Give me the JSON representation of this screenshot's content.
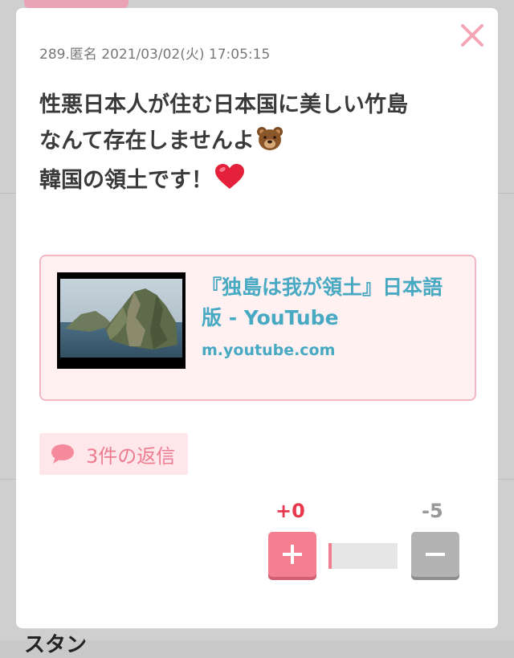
{
  "post": {
    "meta": "289.匿名 2021/03/02(火) 17:05:15",
    "lines": [
      "性悪日本人が住む日本国に美しい竹島",
      "なんて存在しませんよ",
      "韓国の領土です！"
    ],
    "emojis": [
      "bear-face",
      "red-heart"
    ]
  },
  "link_card": {
    "title": "『独島は我が領土』日本語版 - YouTube",
    "domain": "m.youtube.com"
  },
  "replies": {
    "label": "3件の返信"
  },
  "votes": {
    "plus": "+0",
    "minus": "-5",
    "plus_share": 0.0
  },
  "background": {
    "peek_text": "スタン"
  },
  "icons": [
    "close-icon",
    "speech-bubble-icon",
    "plus-icon",
    "minus-icon"
  ],
  "colors": {
    "accent_pink": "#f37f91",
    "link_blue": "#48a9c2",
    "plus_red": "#e8394f"
  }
}
